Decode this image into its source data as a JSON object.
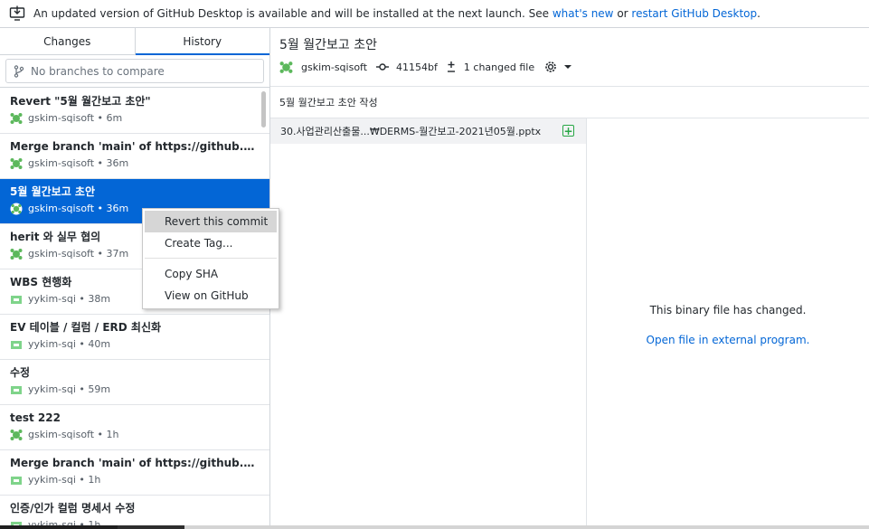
{
  "banner": {
    "text_before": "An updated version of GitHub Desktop is available and will be installed at the next launch. See ",
    "link_whats_new": "what's new",
    "text_or": " or ",
    "link_restart": "restart GitHub Desktop",
    "text_after": ".",
    "icon": "download-desktop-icon"
  },
  "tabs": {
    "changes": "Changes",
    "history": "History",
    "active": "History"
  },
  "compare": {
    "placeholder": "No branches to compare",
    "icon": "branch-icon"
  },
  "commits": [
    {
      "title": "Revert \"5월 월간보고 초안\"",
      "author": "gskim-sqisoft",
      "time": "6m"
    },
    {
      "title": "Merge branch 'main' of https://github.com/s...",
      "author": "gskim-sqisoft",
      "time": "36m"
    },
    {
      "title": "5월 월간보고 초안",
      "author": "gskim-sqisoft",
      "time": "36m"
    },
    {
      "title": "herit 와 실무 협의",
      "author": "gskim-sqisoft",
      "time": "37m"
    },
    {
      "title": "WBS 현행화",
      "author": "yykim-sqi",
      "time": "38m"
    },
    {
      "title": "EV 테이블 / 컬럼 / ERD 최신화",
      "author": "yykim-sqi",
      "time": "40m"
    },
    {
      "title": "수정",
      "author": "yykim-sqi",
      "time": "59m"
    },
    {
      "title": "test 222",
      "author": "gskim-sqisoft",
      "time": "1h"
    },
    {
      "title": "Merge branch 'main' of https://github.com/s...",
      "author": "yykim-sqi",
      "time": "1h"
    },
    {
      "title": "인증/인가 컬럼 명세서 수정",
      "author": "yykim-sqi",
      "time": "1h"
    }
  ],
  "selected_commit_index": 2,
  "context_menu": {
    "items": [
      "Revert this commit",
      "Create Tag...",
      "Copy SHA",
      "View on GitHub"
    ],
    "highlighted": "Revert this commit"
  },
  "commit_detail": {
    "title": "5월 월간보고 초안",
    "author": "gskim-sqisoft",
    "sha": "41154bf",
    "changed_files": "1 changed file",
    "description": "5월 월간보고 초안 작성"
  },
  "files": [
    {
      "path": "30.사업관리산출물...₩DERMS-월간보고-2021년05월.pptx",
      "status": "added"
    }
  ],
  "diff": {
    "message": "This binary file has changed.",
    "open_link": "Open file in external program."
  },
  "colors": {
    "accent": "#0366d6",
    "added": "#28a745",
    "avatar": "#5cb85c"
  }
}
